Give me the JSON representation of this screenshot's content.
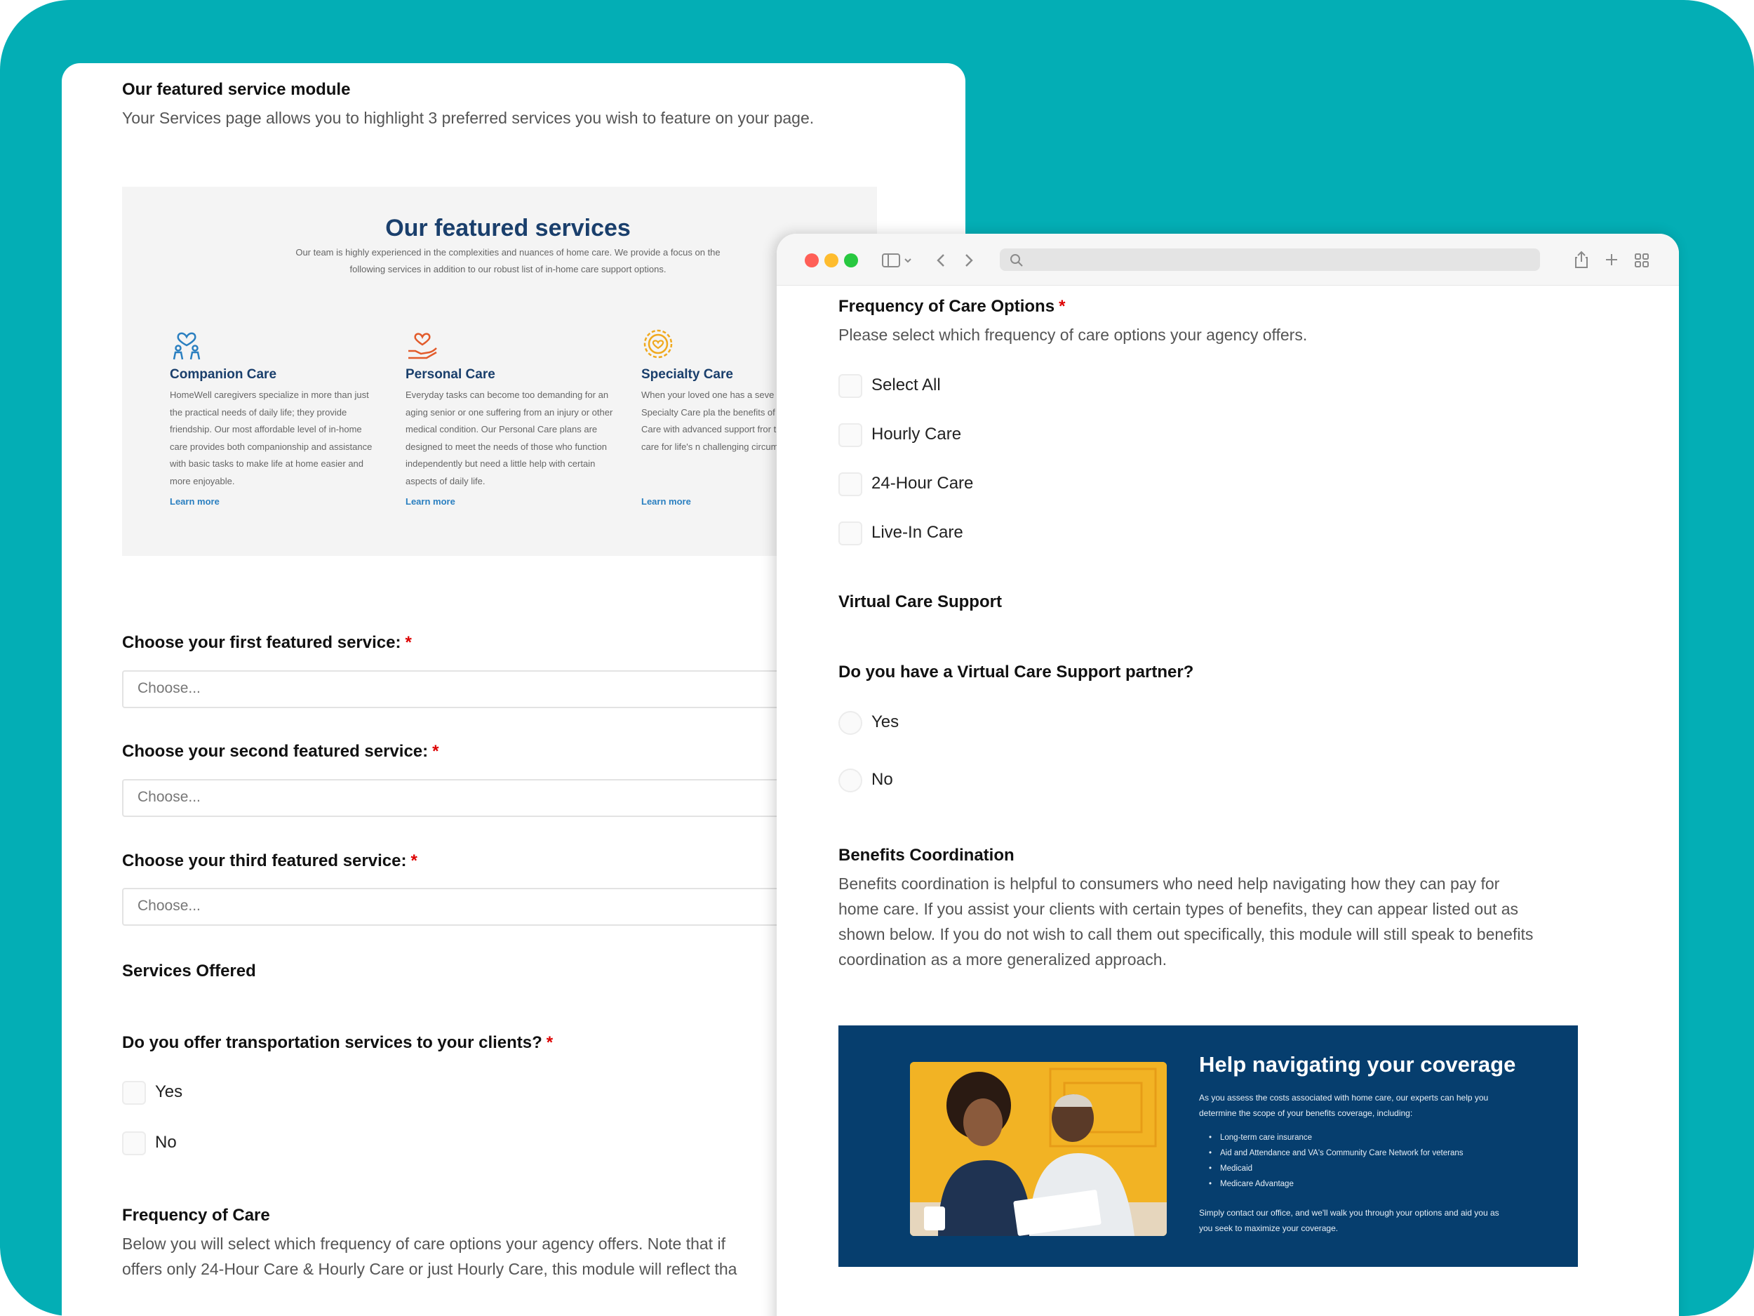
{
  "back": {
    "module_title": "Our featured service module",
    "module_desc": "Your Services page allows you to highlight 3 preferred services you wish to feature on your page.",
    "preview": {
      "title": "Our featured services",
      "intro_1": "Our team is highly experienced in the complexities and nuances of home care. We provide a focus on the",
      "intro_2": "following services in addition to our robust list of in-home care support options.",
      "services": [
        {
          "name": "Companion Care",
          "desc": "HomeWell caregivers specialize in more than just the practical needs of daily life; they provide friendship. Our most affordable level of in-home care provides both companionship and assistance with basic tasks to make life at home easier and more enjoyable.",
          "link": "Learn more"
        },
        {
          "name": "Personal Care",
          "desc": "Everyday tasks can become too demanding for an aging senior or one suffering from an injury or other medical condition. Our Personal Care plans are designed to meet the needs of those who function independently but need a little help with certain aspects of daily life.",
          "link": "Learn more"
        },
        {
          "name": "Specialty Care",
          "desc": "When your loved one has a seve condition, our Specialty Care pla the benefits of Companion Care Care with advanced support fror trained to provide care for life's n challenging circumstances.",
          "link": "Learn more"
        }
      ]
    },
    "first_label": "Choose your first featured service:",
    "second_label": "Choose your second featured service:",
    "third_label": "Choose your third featured service:",
    "choose_placeholder": "Choose...",
    "services_offered": "Services Offered",
    "transport_q": "Do you offer transportation services to your clients?",
    "yes": "Yes",
    "no": "No",
    "freq_title": "Frequency of Care",
    "freq_desc_1": "Below you will select which frequency of care options your agency offers. Note that if",
    "freq_desc_2": "offers only 24-Hour Care & Hourly Care or just Hourly Care, this module will reflect tha",
    "required_mark": "*"
  },
  "front": {
    "freq_options_title": "Frequency of Care Options",
    "freq_options_desc": "Please select which frequency of care options your agency offers.",
    "options": [
      "Select All",
      "Hourly Care",
      "24-Hour Care",
      "Live-In Care"
    ],
    "virtual_title": "Virtual Care Support",
    "virtual_q": "Do you have a Virtual Care Support partner?",
    "yes": "Yes",
    "no": "No",
    "benefits_title": "Benefits Coordination",
    "benefits_desc_1": "Benefits coordination is helpful to consumers who need help navigating how they can pay for",
    "benefits_desc_2": "home care. If you assist your clients with certain types of benefits, they can appear listed out as",
    "benefits_desc_3": "shown below. If you do not wish to call them out specifically, this module will still speak to benefits",
    "benefits_desc_4": "coordination as a more generalized approach.",
    "hero": {
      "title": "Help navigating your coverage",
      "text_1": "As you assess the costs associated with home care, our experts can help you",
      "text_2": "determine the scope of your benefits coverage, including:",
      "items": [
        "Long-term care insurance",
        "Aid and Attendance and VA's Community Care Network for veterans",
        "Medicaid",
        "Medicare Advantage"
      ],
      "closing_1": "Simply contact our office, and we'll walk you through your options and aid you as",
      "closing_2": "you seek to maximize your coverage."
    },
    "required_mark": "*"
  },
  "colors": {
    "teal": "#03aeb5",
    "navy": "#1a3f6c",
    "hero_bg": "#063e6e",
    "required": "#dd0000"
  }
}
